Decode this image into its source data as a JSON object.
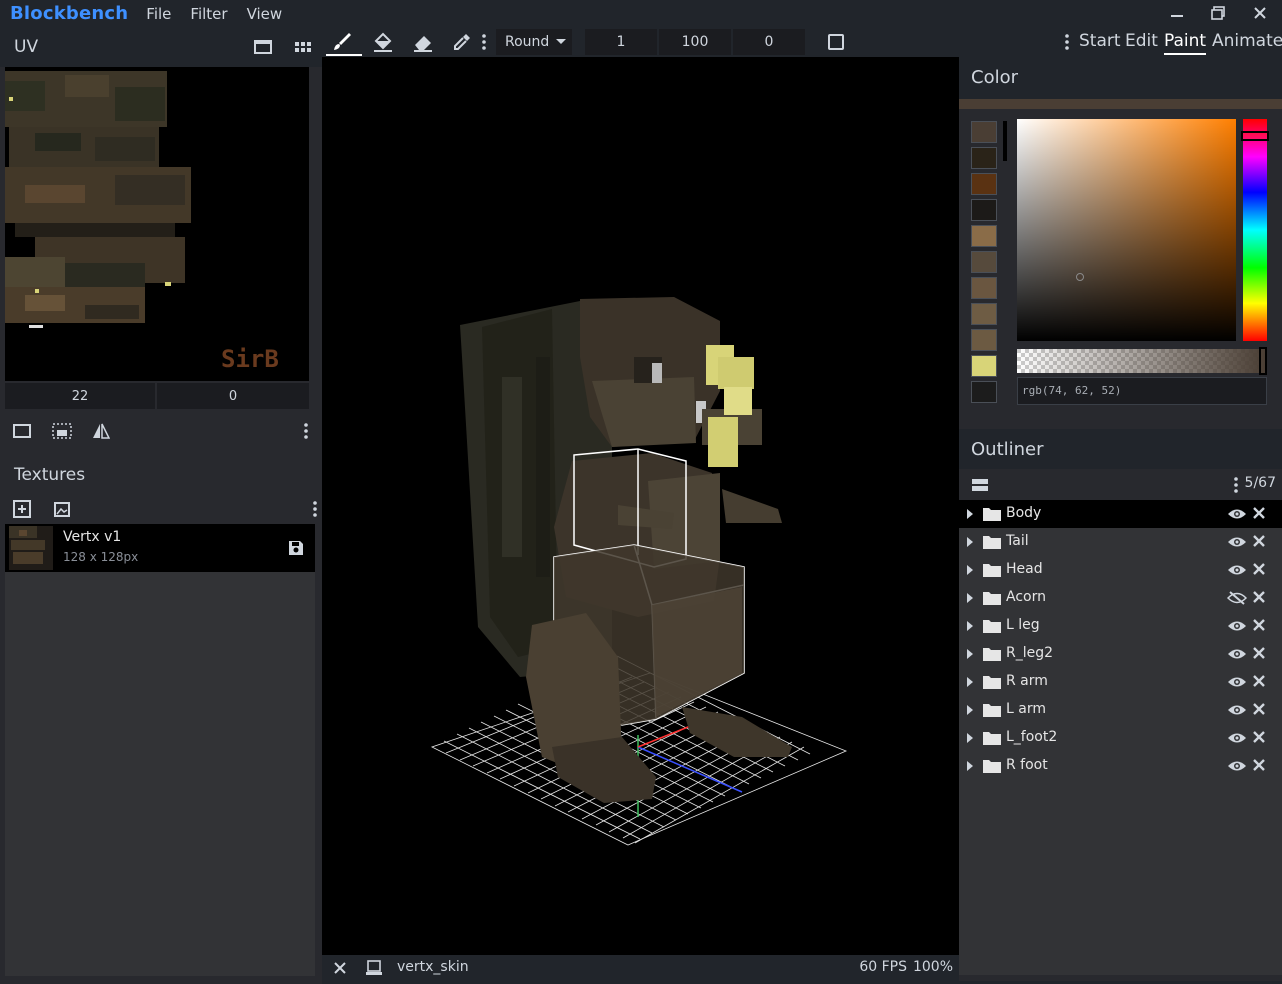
{
  "app": {
    "name": "Blockbench",
    "menu": [
      "File",
      "Filter",
      "View"
    ]
  },
  "uv_panel": {
    "title": "UV",
    "input_x": "22",
    "input_y": "0",
    "texture_signature": "SirB"
  },
  "textures_panel": {
    "title": "Textures",
    "item": {
      "name": "Vertx v1",
      "size": "128 x 128px"
    }
  },
  "toolbar": {
    "brush_shape": "Round",
    "brush_size": "1",
    "opacity": "100",
    "softness": "0",
    "modes": [
      "Start",
      "Edit",
      "Paint",
      "Animate"
    ],
    "active_mode": "Paint"
  },
  "color_panel": {
    "title": "Color",
    "current_color": "#4a3e34",
    "rgb_text": "rgb(74, 62, 52)",
    "palette": [
      "#4a3e34",
      "#2a2318",
      "#5a3212",
      "#1c1a18",
      "#8a6c48",
      "#564a3c",
      "#6a5640",
      "#6e5c44",
      "#6c5a42",
      "#d8d478",
      "#1c1c1c"
    ]
  },
  "outliner": {
    "title": "Outliner",
    "count": "5/67",
    "items": [
      {
        "label": "Body",
        "visible": true,
        "selected": true
      },
      {
        "label": "Tail",
        "visible": true,
        "selected": false
      },
      {
        "label": "Head",
        "visible": true,
        "selected": false
      },
      {
        "label": "Acorn",
        "visible": false,
        "selected": false
      },
      {
        "label": "L leg",
        "visible": true,
        "selected": false
      },
      {
        "label": "R_leg2",
        "visible": true,
        "selected": false
      },
      {
        "label": "R arm",
        "visible": true,
        "selected": false
      },
      {
        "label": "L arm",
        "visible": true,
        "selected": false
      },
      {
        "label": "L_foot2",
        "visible": true,
        "selected": false
      },
      {
        "label": "R foot",
        "visible": true,
        "selected": false
      }
    ]
  },
  "viewport": {
    "file_name": "vertx_skin",
    "fps": "60 FPS",
    "zoom": "100%"
  },
  "colors": {
    "accent": "#3e90ff",
    "panel_bg": "#28292e",
    "header_bg": "#21252b"
  }
}
